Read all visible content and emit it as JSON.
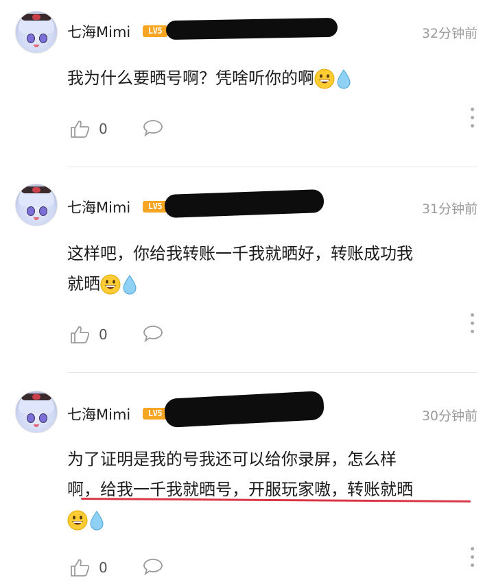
{
  "colors": {
    "level_badge": "#f6a623",
    "redaction": "#0d0d0d",
    "underline_annotation": "#d93648",
    "timestamp": "#9a9a9a"
  },
  "comments": [
    {
      "username": "七海Mimi",
      "level": "LV5",
      "time": "32分钟前",
      "text_line1": "我为什么要晒号啊？凭啥听你的啊",
      "like_count": "0"
    },
    {
      "username": "七海Mimi",
      "level": "LV5",
      "time": "31分钟前",
      "text_line1": "这样吧，你给我转账一千我就晒好，转账成功我",
      "text_line2": "就晒",
      "like_count": "0"
    },
    {
      "username": "七海Mimi",
      "level": "LV5",
      "time": "30分钟前",
      "text_line1": "为了证明是我的号我还可以给你录屏，怎么样",
      "text_line2": "啊，给我一千我就晒号，开服玩家嗷，转账就晒",
      "like_count": "0"
    }
  ],
  "icons": {
    "emoji": "grinning-face-emoji",
    "drop": "droplet-emoji",
    "like": "thumbs-up-icon",
    "reply": "speech-bubble-icon",
    "more": "more-vertical-icon"
  }
}
